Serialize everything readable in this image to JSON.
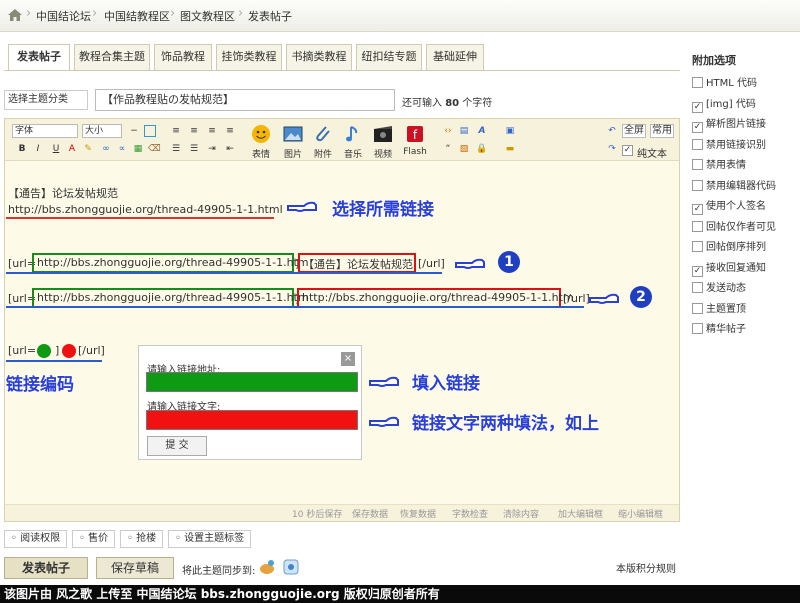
{
  "breadcrumb": [
    "中国结论坛",
    "中国结教程区",
    "图文教程区",
    "发表帖子"
  ],
  "tabs": [
    "发表帖子",
    "教程合集主题",
    "饰品教程",
    "挂饰类教程",
    "书摘类教程",
    "纽扣结专题",
    "基础延伸"
  ],
  "subject": {
    "type_select": "选择主题分类",
    "value": "【作品教程贴の发帖规范】",
    "hint_prefix": "还可输入",
    "hint_count": "80",
    "hint_suffix": "个字符"
  },
  "toolbar": {
    "font": "字体",
    "size": "大小",
    "fullscreen": "全屏",
    "common": "常用",
    "plain_text": "纯文本",
    "big_buttons": [
      "表情",
      "图片",
      "附件",
      "音乐",
      "视频",
      "Flash"
    ]
  },
  "editor": {
    "line1": "【通告】论坛发帖规范",
    "line2": "http://bbs.zhongguojie.org/thread-49905-1-1.html",
    "row1": {
      "prefix": "[url=",
      "url": "http://bbs.zhongguojie.org/thread-49905-1-1.htm",
      "mid": "]",
      "text": "【通告】论坛发帖规范",
      "suffix": "[/url]"
    },
    "row2": {
      "prefix": "[url=",
      "url": "http://bbs.zhongguojie.org/thread-49905-1-1.htm",
      "mid": "]",
      "text": "http://bbs.zhongguojie.org/thread-49905-1-1.htm",
      "suffix": "[/url]"
    },
    "code_prefix": "[url=",
    "code_mid": "]",
    "code_suffix": "[/url]"
  },
  "annotations": {
    "select_link": "选择所需链接",
    "link_code": "链接编码",
    "fill_link": "填入链接",
    "two_ways": "链接文字两种填法，如上",
    "num1": "1",
    "num2": "2"
  },
  "dialog": {
    "url_label": "请输入链接地址:",
    "text_label": "请输入链接文字:",
    "submit": "提 交",
    "close": "×"
  },
  "status_bar": [
    "10 秒后保存",
    "保存数据",
    "恢复数据",
    "字数检查",
    "清除内容",
    "加大编辑框",
    "缩小编辑框"
  ],
  "bottom_options": [
    "阅读权限",
    "售价",
    "抢楼",
    "设置主题标签"
  ],
  "post_button": "发表帖子",
  "draft_button": "保存草稿",
  "sync_label": "将此主题同步到:",
  "rules_link": "本版积分规则",
  "footer": "该图片由 风之歌 上传至 中国结论坛 bbs.zhongguojie.org 版权归原创者所有",
  "side_panel": {
    "title": "附加选项",
    "options": [
      {
        "label": "HTML 代码",
        "checked": false
      },
      {
        "label": "[img] 代码",
        "checked": true
      },
      {
        "label": "解析图片链接",
        "checked": true
      },
      {
        "label": "禁用链接识别",
        "checked": false
      },
      {
        "label": "禁用表情",
        "checked": false
      },
      {
        "label": "禁用编辑器代码",
        "checked": false
      },
      {
        "label": "使用个人签名",
        "checked": true
      },
      {
        "label": "回帖仅作者可见",
        "checked": false
      },
      {
        "label": "回帖倒序排列",
        "checked": false
      },
      {
        "label": "接收回复通知",
        "checked": true
      },
      {
        "label": "发送动态",
        "checked": false
      },
      {
        "label": "主题置顶",
        "checked": false
      },
      {
        "label": "精华帖子",
        "checked": false
      }
    ]
  },
  "colors": {
    "accent_blue": "#2a3fd6",
    "green": "#0e9a12",
    "red": "#f21111"
  }
}
